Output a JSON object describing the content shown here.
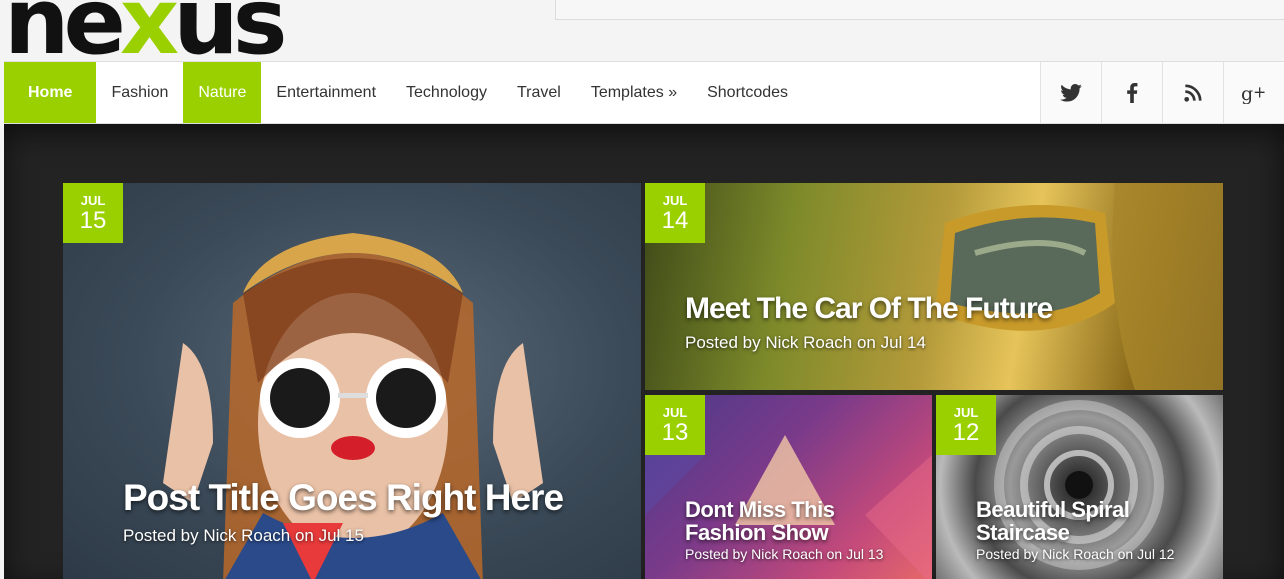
{
  "brand": {
    "logo_left": "ne",
    "logo_x": "x",
    "logo_right": "us",
    "accent_color": "#9bd000"
  },
  "nav": {
    "items": [
      {
        "label": "Home"
      },
      {
        "label": "Fashion"
      },
      {
        "label": "Nature"
      },
      {
        "label": "Entertainment"
      },
      {
        "label": "Technology"
      },
      {
        "label": "Travel"
      },
      {
        "label": "Templates »"
      },
      {
        "label": "Shortcodes"
      }
    ],
    "social": [
      "twitter-icon",
      "facebook-icon",
      "rss-icon",
      "google-plus-icon"
    ]
  },
  "posts": [
    {
      "month": "JUL",
      "day": "15",
      "title": "Post Title Goes Right Here",
      "meta": "Posted by Nick Roach on Jul 15"
    },
    {
      "month": "JUL",
      "day": "14",
      "title": "Meet The Car Of The Future",
      "meta": "Posted by Nick Roach on Jul 14"
    },
    {
      "month": "JUL",
      "day": "13",
      "title": "Dont Miss This Fashion Show",
      "meta": "Posted by Nick Roach on Jul 13"
    },
    {
      "month": "JUL",
      "day": "12",
      "title": "Beautiful Spiral Staircase",
      "meta": "Posted by Nick Roach on Jul 12"
    }
  ]
}
